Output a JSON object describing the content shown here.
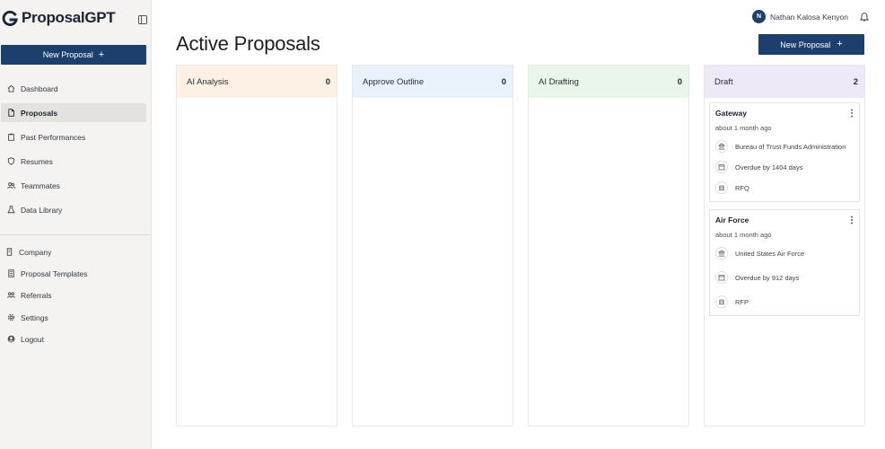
{
  "app": {
    "name": "ProposalGPT"
  },
  "sidebar": {
    "new_button": {
      "label": "New Proposal",
      "icon": "plus"
    },
    "items": [
      {
        "label": "Dashboard",
        "icon": "home-icon",
        "active": false
      },
      {
        "label": "Proposals",
        "icon": "file-icon",
        "active": true
      },
      {
        "label": "Past Performances",
        "icon": "clipboard-icon",
        "active": false
      },
      {
        "label": "Resumes",
        "icon": "shield-icon",
        "active": false
      },
      {
        "label": "Teammates",
        "icon": "users-icon",
        "active": false
      },
      {
        "label": "Data Library",
        "icon": "flask-icon",
        "active": false
      }
    ],
    "secondary_items": [
      {
        "label": "Company",
        "icon": "building-icon"
      },
      {
        "label": "Proposal Templates",
        "icon": "template-icon"
      },
      {
        "label": "Referrals",
        "icon": "people-icon"
      },
      {
        "label": "Settings",
        "icon": "gear-icon"
      },
      {
        "label": "Logout",
        "icon": "user-circle-icon"
      }
    ]
  },
  "header": {
    "user": {
      "initial": "N",
      "name": "Nathan Kalosa Kenyon"
    },
    "notifications_icon": "bell-icon"
  },
  "main": {
    "title": "Active Proposals",
    "new_button": {
      "label": "New Proposal",
      "icon": "plus"
    },
    "columns": [
      {
        "name": "AI Analysis",
        "count": "0",
        "color": "#fdf1e6",
        "cards": []
      },
      {
        "name": "Approve Outline",
        "count": "0",
        "color": "#e9f1fb",
        "cards": []
      },
      {
        "name": "AI Drafting",
        "count": "0",
        "color": "#e9f5ea",
        "cards": []
      },
      {
        "name": "Draft",
        "count": "2",
        "color": "#efe8f6",
        "cards": [
          {
            "title": "Gateway",
            "time": "about 1 month ago",
            "agency": "Bureau of Trust Funds Administration",
            "due": "Overdue by 1404 days",
            "type": "RFQ"
          },
          {
            "title": "Air Force",
            "time": "about 1 month ago",
            "agency": "United States Air Force",
            "due": "Overdue by 912 days",
            "type": "RFP"
          }
        ]
      }
    ]
  }
}
